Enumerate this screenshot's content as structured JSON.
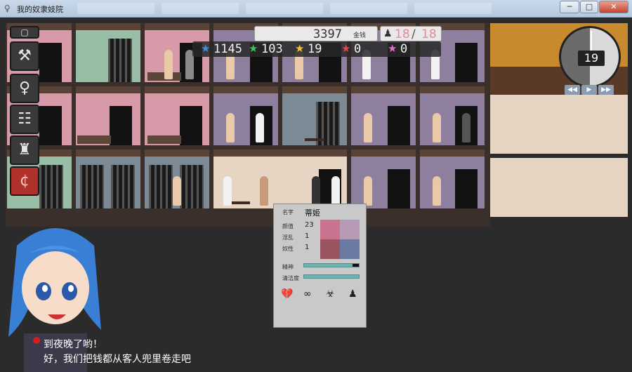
{
  "window": {
    "title": "我的奴隶妓院",
    "minimize_glyph": "─",
    "maximize_glyph": "□",
    "close_glyph": "✕"
  },
  "resources": {
    "money": "3397",
    "money_unit": "金钱",
    "pop_current": "18",
    "pop_separator": "/",
    "pop_max": "18",
    "stars": [
      {
        "icon": "star-blue-icon",
        "color": "#3f8fe0",
        "value": "1145"
      },
      {
        "icon": "star-green-icon",
        "color": "#3fc460",
        "value": "103"
      },
      {
        "icon": "star-yellow-icon",
        "color": "#f2c23a",
        "value": "19"
      },
      {
        "icon": "star-red-icon",
        "color": "#e04a4a",
        "value": "0"
      },
      {
        "icon": "star-pink-icon",
        "color": "#e070c8",
        "value": "0"
      }
    ]
  },
  "clock": {
    "day": "19",
    "speed_buttons": [
      "◀◀",
      "▶",
      "▶▶"
    ]
  },
  "toolbar": [
    {
      "name": "menu-icon",
      "glyph": "▢"
    },
    {
      "name": "hammer-icon",
      "glyph": "⚒"
    },
    {
      "name": "person-icon",
      "glyph": "♀"
    },
    {
      "name": "org-chart-icon",
      "glyph": "☷"
    },
    {
      "name": "castle-icon",
      "glyph": "♜"
    },
    {
      "name": "coin-icon",
      "glyph": "¢"
    }
  ],
  "panel": {
    "name_label": "名字",
    "name": "蒂姬",
    "looks_label": "颜值",
    "looks": "23",
    "lewd_label": "淫乱",
    "lewd": "1",
    "slave_label": "奴性",
    "slave": "1",
    "spirit_label": "精神",
    "spirit_value": 0.88,
    "clean_label": "清洁度",
    "clean_value": 1.0,
    "icons": [
      "broken-heart-icon",
      "handcuffs-icon",
      "biohazard-icon",
      "bag-icon"
    ],
    "icon_glyphs": [
      "💔",
      "∞",
      "☣",
      "♟"
    ],
    "colors": [
      "#c9738f",
      "#b69ab6",
      "#9b5560",
      "#6b7aa3"
    ]
  },
  "dialogue": {
    "line1": "到夜晚了哟！",
    "line2": "好，我们把钱都从客人兜里卷走吧"
  }
}
